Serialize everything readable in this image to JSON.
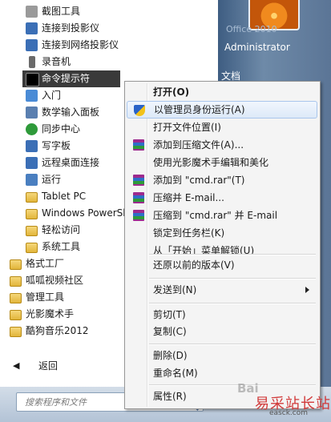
{
  "start_menu": {
    "programs": [
      {
        "label": "截图工具",
        "icon": "snipping-tool-icon",
        "color": "#9a9a9a"
      },
      {
        "label": "连接到投影仪",
        "icon": "projector-icon",
        "color": "#3b6fb6"
      },
      {
        "label": "连接到网络投影仪",
        "icon": "network-projector-icon",
        "color": "#3b6fb6"
      },
      {
        "label": "录音机",
        "icon": "microphone-icon",
        "color": "#6a6a6a"
      },
      {
        "label": "命令提示符",
        "icon": "cmd-icon",
        "color": "#000000",
        "selected": true
      },
      {
        "label": "入门",
        "icon": "getting-started-icon",
        "color": "#4a8bd6"
      },
      {
        "label": "数学输入面板",
        "icon": "math-input-icon",
        "color": "#5a7fb0"
      },
      {
        "label": "同步中心",
        "icon": "sync-center-icon",
        "color": "#2e9a3a"
      },
      {
        "label": "写字板",
        "icon": "wordpad-icon",
        "color": "#3b6fb6"
      },
      {
        "label": "远程桌面连接",
        "icon": "remote-desktop-icon",
        "color": "#3b6fb6"
      },
      {
        "label": "运行",
        "icon": "run-icon",
        "color": "#4a7fc0"
      },
      {
        "label": "Tablet PC",
        "icon": "folder-icon",
        "color": "#e2b53b",
        "folder": true
      },
      {
        "label": "Windows PowerShell",
        "icon": "folder-icon",
        "color": "#e2b53b",
        "folder": true
      },
      {
        "label": "轻松访问",
        "icon": "folder-icon",
        "color": "#e2b53b",
        "folder": true
      },
      {
        "label": "系统工具",
        "icon": "folder-icon",
        "color": "#e2b53b",
        "folder": true
      }
    ],
    "root_folders": [
      {
        "label": "格式工厂"
      },
      {
        "label": "呱呱视频社区"
      },
      {
        "label": "管理工具"
      },
      {
        "label": "光影魔术手"
      },
      {
        "label": "酷狗音乐2012"
      }
    ],
    "back_label": "返回",
    "search_placeholder": "搜索程序和文件",
    "user": {
      "name": "Administrator",
      "ghost_text": "Office 2010"
    },
    "right_items": {
      "documents": "文档"
    }
  },
  "context_menu": {
    "items": [
      {
        "label": "打开(O)",
        "bold": true
      },
      {
        "label": "以管理员身份运行(A)",
        "icon": "uac-shield-icon",
        "highlighted": true
      },
      {
        "label": "打开文件位置(I)"
      },
      {
        "label": "添加到压缩文件(A)...",
        "icon": "winrar-icon"
      },
      {
        "label": "使用光影魔术手编辑和美化"
      },
      {
        "label": "添加到 \"cmd.rar\"(T)",
        "icon": "winrar-icon"
      },
      {
        "label": "压缩并 E-mail...",
        "icon": "winrar-icon"
      },
      {
        "label": "压缩到 \"cmd.rar\" 并 E-mail",
        "icon": "winrar-icon"
      },
      {
        "label": "锁定到任务栏(K)"
      },
      {
        "label": "从「开始」菜单解锁(U)"
      },
      {
        "label": "还原以前的版本(V)"
      },
      {
        "label": "发送到(N)",
        "submenu": true
      },
      {
        "label": "剪切(T)"
      },
      {
        "label": "复制(C)"
      },
      {
        "label": "删除(D)"
      },
      {
        "label": "重命名(M)"
      },
      {
        "label": "属性(R)"
      }
    ]
  },
  "watermark": {
    "text": "易采站长站",
    "sub": "easck.com",
    "baidu": "Bai"
  },
  "colors": {
    "accent_highlight": "#dde9f8",
    "selected_row": "#3a3a3a",
    "aero_panel": "#5b7596"
  }
}
